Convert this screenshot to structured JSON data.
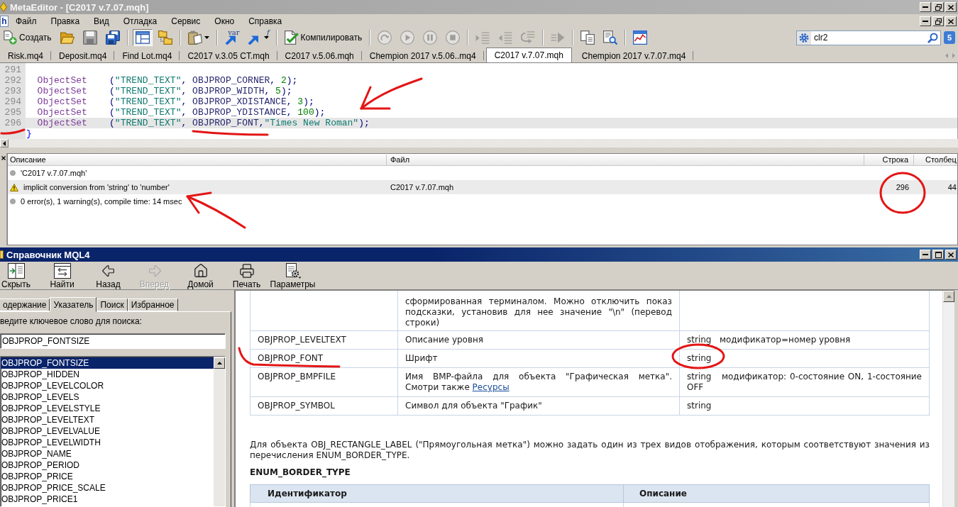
{
  "window": {
    "title": "MetaEditor - [C2017 v.7.07.mqh]"
  },
  "menu": {
    "document_icon": "h",
    "items": [
      "Файл",
      "Правка",
      "Вид",
      "Отладка",
      "Сервис",
      "Окно",
      "Справка"
    ]
  },
  "toolbar": {
    "groups": [
      [
        {
          "kind": "new",
          "label": "Создать",
          "pressed": false,
          "disabled": false
        },
        {
          "kind": "open",
          "pressed": false,
          "disabled": false
        },
        {
          "kind": "save",
          "pressed": false,
          "disabled": false
        },
        {
          "kind": "saveall",
          "pressed": false,
          "disabled": false
        }
      ],
      [
        {
          "kind": "navigator",
          "pressed": true,
          "disabled": false
        },
        {
          "kind": "folders",
          "pressed": false,
          "disabled": false
        }
      ],
      [
        {
          "kind": "clipboard",
          "dropdown": true,
          "pressed": false,
          "disabled": false
        }
      ],
      [
        {
          "kind": "variable",
          "glyph": "var",
          "pressed": false,
          "disabled": false
        },
        {
          "kind": "function",
          "glyph": "f",
          "dropdown": true,
          "pressed": false,
          "disabled": false
        }
      ],
      [
        {
          "kind": "compile",
          "label": "Компилировать",
          "pressed": false,
          "disabled": false
        }
      ],
      [
        {
          "kind": "step",
          "pressed": false,
          "disabled": true
        },
        {
          "kind": "play",
          "pressed": false,
          "disabled": true
        },
        {
          "kind": "pause",
          "pressed": false,
          "disabled": true
        },
        {
          "kind": "stop",
          "pressed": false,
          "disabled": true
        }
      ],
      [
        {
          "kind": "indent",
          "pressed": false,
          "disabled": true
        },
        {
          "kind": "outdent",
          "pressed": false,
          "disabled": true
        },
        {
          "kind": "comment",
          "pressed": false,
          "disabled": true
        }
      ],
      [
        {
          "kind": "next",
          "pressed": false,
          "disabled": true
        }
      ],
      [
        {
          "kind": "copy",
          "pressed": false,
          "disabled": false
        },
        {
          "kind": "preview",
          "pressed": false,
          "disabled": false
        }
      ],
      [
        {
          "kind": "chart",
          "pressed": false,
          "disabled": false
        }
      ]
    ],
    "search": {
      "value": "clr2"
    },
    "badge": "5"
  },
  "tabs": [
    {
      "label": "Risk.mq4",
      "selected": false
    },
    {
      "label": "Deposit.mq4",
      "selected": false
    },
    {
      "label": "Find Lot.mq4",
      "selected": false
    },
    {
      "label": "C2017 v.3.05 CT.mqh",
      "selected": false
    },
    {
      "label": "C2017 v.5.06.mqh",
      "selected": false
    },
    {
      "label": "Chempion 2017 v.5.06..mq4",
      "selected": false
    },
    {
      "label": "C2017 v.7.07.mqh",
      "selected": true
    },
    {
      "label": "Chempion 2017 v.7.07.mq4",
      "selected": false
    }
  ],
  "editor": {
    "lines": [
      {
        "number": "291",
        "selected": false
      },
      {
        "number": "292",
        "selected": false,
        "tokens": [
          {
            "kind": "function",
            "text": "  ObjectSet"
          },
          {
            "kind": "punct",
            "text": "    ("
          },
          {
            "kind": "string",
            "text": "\"TREND_TEXT\""
          },
          {
            "kind": "punct",
            "text": ", "
          },
          {
            "kind": "constant",
            "text": "OBJPROP_CORNER"
          },
          {
            "kind": "punct",
            "text": ", "
          },
          {
            "kind": "number",
            "text": "2"
          },
          {
            "kind": "punct",
            "text": ");"
          }
        ]
      },
      {
        "number": "293",
        "selected": false,
        "tokens": [
          {
            "kind": "function",
            "text": "  ObjectSet"
          },
          {
            "kind": "punct",
            "text": "    ("
          },
          {
            "kind": "string",
            "text": "\"TREND_TEXT\""
          },
          {
            "kind": "punct",
            "text": ", "
          },
          {
            "kind": "constant",
            "text": "OBJPROP_WIDTH"
          },
          {
            "kind": "punct",
            "text": ", "
          },
          {
            "kind": "number",
            "text": "5"
          },
          {
            "kind": "punct",
            "text": ");"
          }
        ]
      },
      {
        "number": "294",
        "selected": false,
        "tokens": [
          {
            "kind": "function",
            "text": "  ObjectSet"
          },
          {
            "kind": "punct",
            "text": "    ("
          },
          {
            "kind": "string",
            "text": "\"TREND_TEXT\""
          },
          {
            "kind": "punct",
            "text": ", "
          },
          {
            "kind": "constant",
            "text": "OBJPROP_XDISTANCE"
          },
          {
            "kind": "punct",
            "text": ", "
          },
          {
            "kind": "number",
            "text": "3"
          },
          {
            "kind": "punct",
            "text": ");"
          }
        ]
      },
      {
        "number": "295",
        "selected": false,
        "tokens": [
          {
            "kind": "function",
            "text": "  ObjectSet"
          },
          {
            "kind": "punct",
            "text": "    ("
          },
          {
            "kind": "string",
            "text": "\"TREND_TEXT\""
          },
          {
            "kind": "punct",
            "text": ", "
          },
          {
            "kind": "constant",
            "text": "OBJPROP_YDISTANCE"
          },
          {
            "kind": "punct",
            "text": ", "
          },
          {
            "kind": "number",
            "text": "100"
          },
          {
            "kind": "punct",
            "text": ");"
          }
        ]
      },
      {
        "number": "296",
        "selected": true,
        "tokens": [
          {
            "kind": "function",
            "text": "  ObjectSet"
          },
          {
            "kind": "punct",
            "text": "    ("
          },
          {
            "kind": "string",
            "text": "\"TREND_TEXT\""
          },
          {
            "kind": "punct",
            "text": ", "
          },
          {
            "kind": "constant",
            "text": "OBJPROP_FONT"
          },
          {
            "kind": "punct",
            "text": ","
          },
          {
            "kind": "string",
            "text": "\"Times New Roman\""
          },
          {
            "kind": "punct",
            "text": ");"
          }
        ]
      },
      {
        "selected": false,
        "tokens": [
          {
            "kind": "brace",
            "text": "}"
          }
        ]
      }
    ]
  },
  "output": {
    "columns": [
      "Описание",
      "Файл",
      "Строка",
      "Столбец"
    ],
    "rows": [
      {
        "kind": "info",
        "description": "'C2017 v.7.07.mqh'",
        "selected": false
      },
      {
        "kind": "warning",
        "description": "implicit conversion from 'string' to 'number'",
        "file": "C2017 v.7.07.mqh",
        "line": "296",
        "column": "44",
        "selected": true
      },
      {
        "kind": "info",
        "description": "0 error(s), 1 warning(s), compile time: 14 msec",
        "selected": false
      }
    ]
  },
  "help": {
    "title": "Справочник MQL4",
    "toolbar": [
      {
        "kind": "hide",
        "label": "Скрыть",
        "disabled": false
      },
      {
        "kind": "find",
        "label": "Найти",
        "disabled": false
      },
      {
        "kind": "back",
        "label": "Назад",
        "disabled": false
      },
      {
        "kind": "forward",
        "label": "Вперед",
        "disabled": true
      },
      {
        "kind": "home",
        "label": "Домой",
        "disabled": false
      },
      {
        "kind": "print",
        "label": "Печать",
        "disabled": false
      },
      {
        "kind": "options",
        "label": "Параметры",
        "disabled": false
      }
    ],
    "tabs": [
      {
        "label": "одержание",
        "selected": false
      },
      {
        "label": "Указатель",
        "selected": true
      },
      {
        "label": "Поиск",
        "selected": false
      },
      {
        "label": "Избранное",
        "selected": false
      }
    ],
    "search_label": "ведите ключевое слово для поиска:",
    "search": {
      "value": "OBJPROP_FONTSIZE"
    },
    "index": [
      {
        "label": "OBJPROP_FONTSIZE",
        "selected": true
      },
      {
        "label": "OBJPROP_HIDDEN",
        "selected": false
      },
      {
        "label": "OBJPROP_LEVELCOLOR",
        "selected": false
      },
      {
        "label": "OBJPROP_LEVELS",
        "selected": false
      },
      {
        "label": "OBJPROP_LEVELSTYLE",
        "selected": false
      },
      {
        "label": "OBJPROP_LEVELTEXT",
        "selected": false
      },
      {
        "label": "OBJPROP_LEVELVALUE",
        "selected": false
      },
      {
        "label": "OBJPROP_LEVELWIDTH",
        "selected": false
      },
      {
        "label": "OBJPROP_NAME",
        "selected": false
      },
      {
        "label": "OBJPROP_PERIOD",
        "selected": false
      },
      {
        "label": "OBJPROP_PRICE",
        "selected": false
      },
      {
        "label": "OBJPROP_PRICE_SCALE",
        "selected": false
      },
      {
        "label": "OBJPROP_PRICE1",
        "selected": false
      }
    ],
    "properties": [
      {
        "description": "сформированная терминалом. Можно отключить показ подсказки, установив для нее значение \"\\n\" (перевод строки)"
      },
      {
        "id": "OBJPROP_LEVELTEXT",
        "description": "Описание уровня",
        "type": "string   модификатор=номер уровня"
      },
      {
        "id": "OBJPROP_FONT",
        "description": "Шрифт",
        "type": "string"
      },
      {
        "id": "OBJPROP_BMPFILE",
        "description": "Имя BMP-файла для объекта \"Графическая метка\". Смотри также",
        "link": "Ресурсы",
        "type": "string   модификатор: 0-состояние ON, 1-состояние OFF"
      },
      {
        "id": "OBJPROP_SYMBOL",
        "description": "Символ для объекта \"График\"",
        "type": "string"
      }
    ],
    "paragraph": "Для объекта OBJ_RECTANGLE_LABEL (\"Прямоугольная метка\") можно задать один из трех видов отображения, которым соответствуют значения из перечисления ENUM_BORDER_TYPE.",
    "heading": "ENUM_BORDER_TYPE",
    "enum_table": {
      "columns": [
        "Идентификатор",
        "Описание"
      ]
    }
  },
  "annotations": [
    {
      "kind": "arrow"
    },
    {
      "kind": "underline"
    },
    {
      "kind": "underline"
    },
    {
      "kind": "arrow"
    },
    {
      "kind": "circle"
    },
    {
      "kind": "underline"
    },
    {
      "kind": "circle"
    }
  ]
}
